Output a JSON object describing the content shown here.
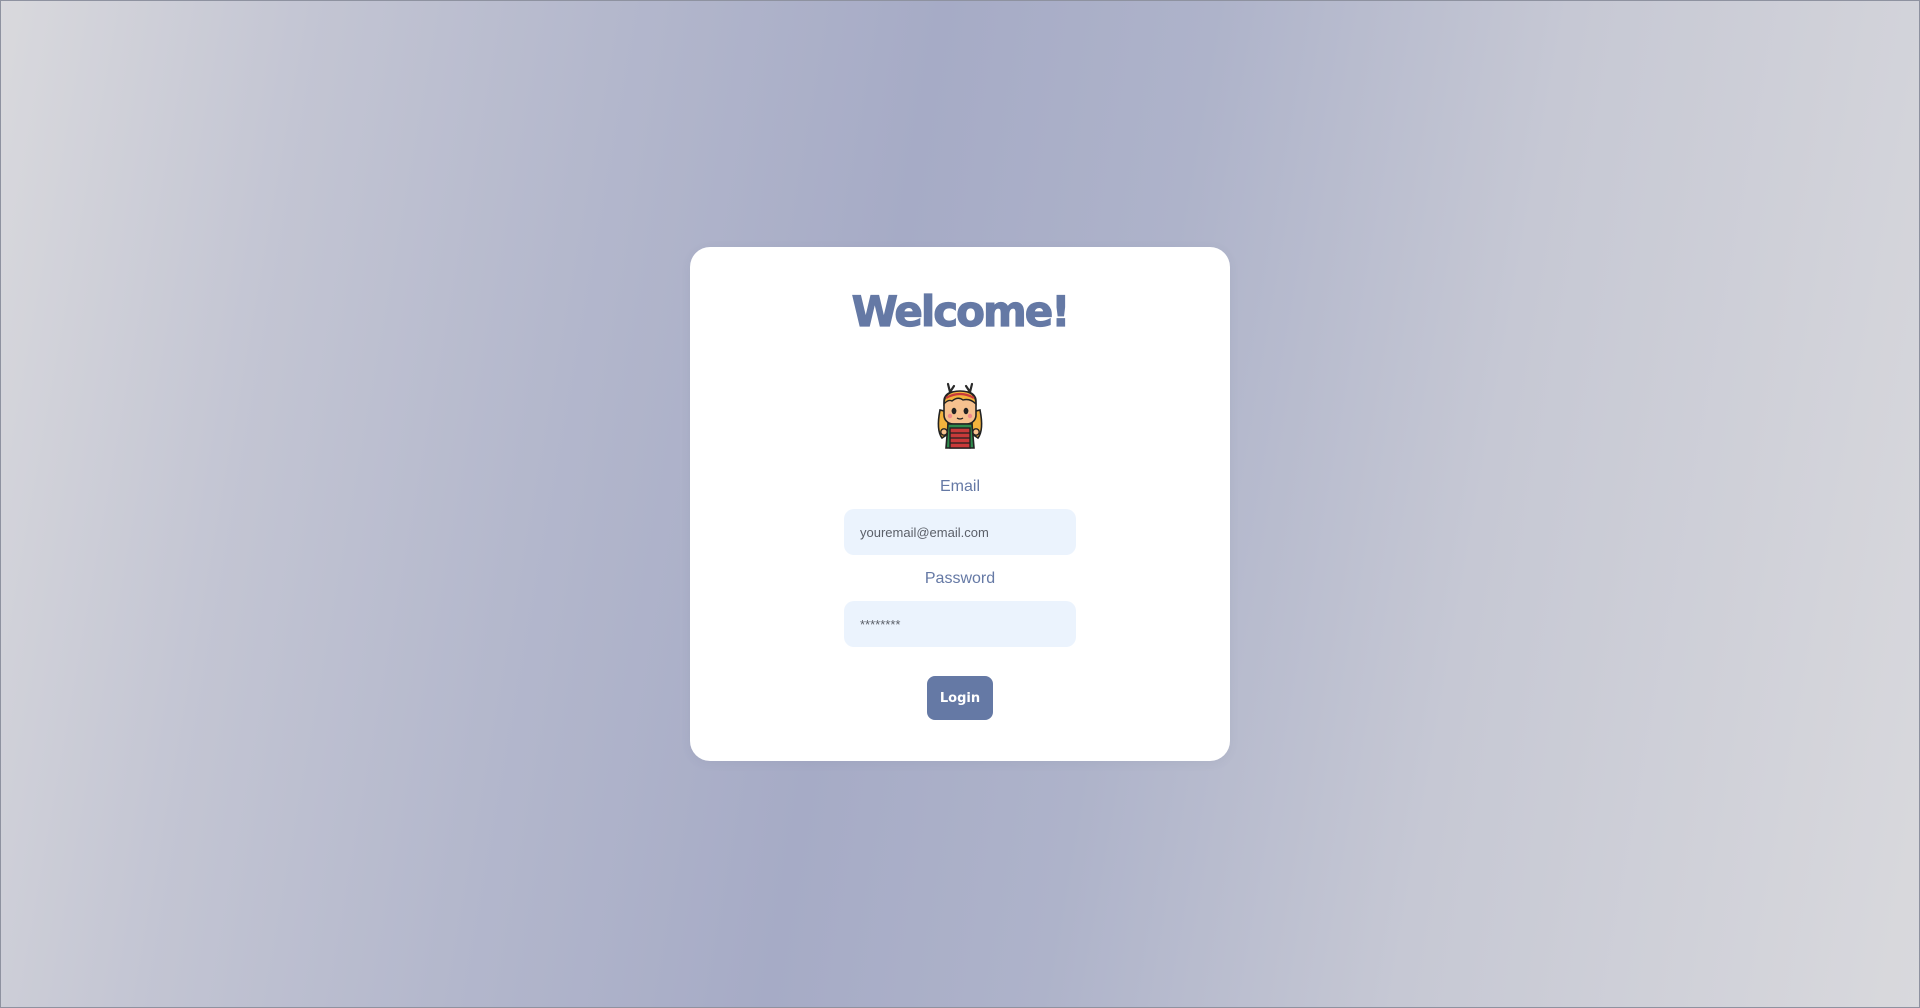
{
  "login": {
    "title": "Welcome!",
    "avatar_icon": "girl-character-avatar-icon",
    "email_label": "Email",
    "email_placeholder": "youremail@email.com",
    "password_label": "Password",
    "password_value": "********",
    "login_button": "Login"
  },
  "colors": {
    "accent": "#6579a5",
    "input_bg": "#ebf3fd",
    "card_bg": "#ffffff"
  }
}
